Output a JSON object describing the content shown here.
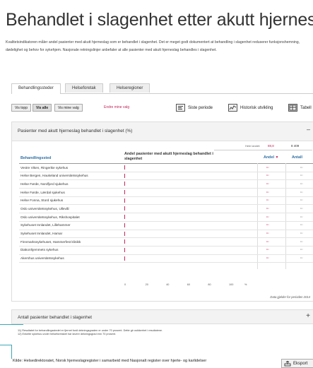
{
  "page": {
    "title": "Behandlet i slagenhet etter akutt hjerneslag",
    "intro": "Kvalitetsindikatoren måler andel pasienter med akutt hjerneslag som er behandlet i slagenhet. Det er meget godt dokumentert at behandling i slagenhet reduserer funksjonshemning, dødelighet og behov for sykehjem. Nasjonale retningslinjer anbefaler at alle pasienter med akutt hjerneslag behandles i slagenhet."
  },
  "tabs": [
    {
      "label": "Behandlingssteder"
    },
    {
      "label": "Helseforetak"
    },
    {
      "label": "Helseregioner"
    }
  ],
  "toolbar": {
    "vis_topp": "Vis topp",
    "vis_alle": "Vis alle",
    "vis_mine": "Vis mine valg",
    "endre": "Endre mine valg",
    "siste_periode": "Siste periode",
    "historisk": "Historisk utvikling",
    "tabell": "Tabell"
  },
  "panel": {
    "title": "Pasienter med akutt hjerneslag behandlet i slagenhet (%)",
    "collapse": "–",
    "hele_landet_label": "Hele landet:",
    "hele_landet_andel": "88,8",
    "hele_landet_antall": "8 409",
    "col_name": "Behandlingssted",
    "col_bar": "Andel pasienter med akutt hjerneslag behandlet i slagenhet",
    "col_andel": "Andel",
    "col_andel_arrow": "▼",
    "col_antall": "Antall",
    "axis_unit": "%",
    "footnote": "Data gjelder for perioden 2014"
  },
  "rows": [
    {
      "name": "Vestre Viken, Ringerike sykehus",
      "andel": "¹¹⁾",
      "antall": "¹¹⁾"
    },
    {
      "name": "Helse Bergen, Haukeland universitetssykehus",
      "andel": "¹¹⁾",
      "antall": "¹¹⁾"
    },
    {
      "name": "Helse Førde, Nordfjord sjukehus",
      "andel": "¹¹⁾",
      "antall": "¹¹⁾"
    },
    {
      "name": "Helse Førde, Lærdal sjukehus",
      "andel": "¹¹⁾",
      "antall": "¹¹⁾"
    },
    {
      "name": "Helse Fonna, Stord sjukehus",
      "andel": "¹¹⁾",
      "antall": "¹¹⁾"
    },
    {
      "name": "Oslo universitetssykehus, Ullevål",
      "andel": "¹¹⁾",
      "antall": "¹¹⁾"
    },
    {
      "name": "Oslo universitetssykehus, Rikshospitalet",
      "andel": "¹¹⁾",
      "antall": "¹¹⁾"
    },
    {
      "name": "Sykehuset Innlandet, Lillehammer",
      "andel": "¹¹⁾",
      "antall": "¹¹⁾"
    },
    {
      "name": "Sykehuset Innlandet, Hamar",
      "andel": "¹¹⁾",
      "antall": "¹¹⁾"
    },
    {
      "name": "Finnmarkssykehuset, Hammerfest klinikk",
      "andel": "¹¹⁾",
      "antall": "¹¹⁾"
    },
    {
      "name": "Diakonhjemmets sykehus",
      "andel": "¹¹⁾",
      "antall": "¹¹⁾"
    },
    {
      "name": "Akershus universitetssykehus",
      "andel": "¹¹⁾",
      "antall": "¹¹⁾"
    }
  ],
  "axis_ticks": [
    "0",
    "20",
    "40",
    "60",
    "80",
    "100"
  ],
  "panel2": {
    "title": "Antall pasienter behandlet i slagenhet",
    "expand": "+"
  },
  "notes": [
    "11) Resultatet for behandlingsstedet er fjernet fordi dekningsgraden er under 70 prosent. Dette gir usikkerhet i resultatene.",
    "12) Enkelte sykehus under helseforetaket har lavere dekningsgrad enn 70 prosent."
  ],
  "footer": {
    "kilde": "Kilde: Helsedirektoratet, Norsk hjerneslagregister i samarbeid med Nasjonalt register over hjerte- og karlidelser",
    "eksport": "Eksport"
  },
  "colors": {
    "accent": "#c0285a",
    "header_blue": "#2f6fa3",
    "teal": "#3ea7b7"
  }
}
